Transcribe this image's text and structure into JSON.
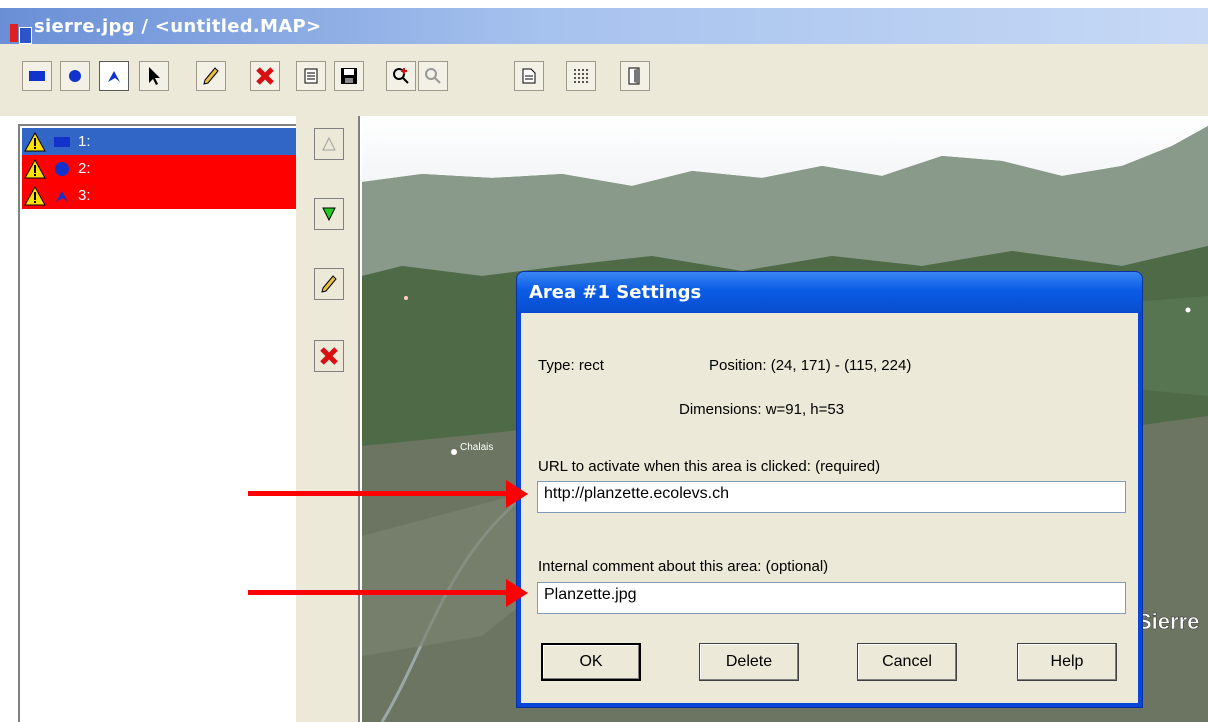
{
  "window": {
    "title": "sierre.jpg / <untitled.MAP>"
  },
  "toolbar": {
    "buttons": [
      "rectangle-tool",
      "circle-tool",
      "polygon-tool",
      "pointer-tool",
      "edit-tool",
      "delete-tool",
      "properties-tool",
      "save-tool",
      "zoom-in-tool",
      "zoom-out-tool",
      "html-tool",
      "grid-tool",
      "exit-tool"
    ]
  },
  "areas": [
    {
      "label": "1:",
      "shape": "rect",
      "color": "#3166c6"
    },
    {
      "label": "2:",
      "shape": "circle",
      "color": "#ff0000"
    },
    {
      "label": "3:",
      "shape": "polygon",
      "color": "#ff0000"
    }
  ],
  "map": {
    "labels": {
      "town1": "Chalais",
      "town2": "Sierre"
    }
  },
  "dialog": {
    "title": "Area #1 Settings",
    "type": "Type: rect",
    "position": "Position:  (24, 171) - (115, 224)",
    "dimensions": "Dimensions: w=91, h=53",
    "url_label": "URL to activate when this area is clicked: (required)",
    "url_value": "http://planzette.ecolevs.ch",
    "comment_label": "Internal comment about this area: (optional)",
    "comment_value": "Planzette.jpg",
    "ok": "OK",
    "delete": "Delete",
    "cancel": "Cancel",
    "help": "Help"
  }
}
